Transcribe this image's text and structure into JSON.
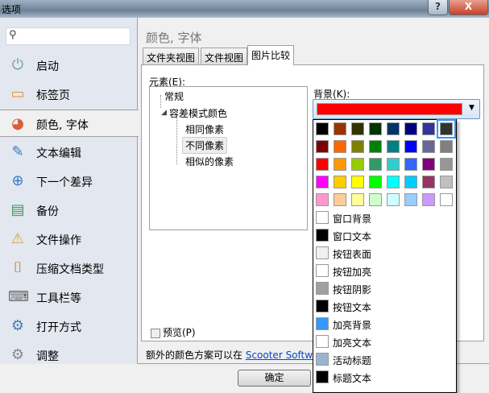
{
  "window": {
    "title": "选项",
    "help": "?",
    "close": "X"
  },
  "sidebar": {
    "search_placeholder": "",
    "items": [
      {
        "label": "启动",
        "icon": "power-icon",
        "glyph": "⏻",
        "color": "#6aa88a"
      },
      {
        "label": "标签页",
        "icon": "tab-icon",
        "glyph": "▭",
        "color": "#e8913a"
      },
      {
        "label": "颜色, 字体",
        "icon": "palette-icon",
        "glyph": "◕",
        "color": "#d9603b",
        "selected": true
      },
      {
        "label": "文本编辑",
        "icon": "notepad-pencil-icon",
        "glyph": "✎",
        "color": "#3a78c2"
      },
      {
        "label": "下一个差异",
        "icon": "arrow-down-circle-icon",
        "glyph": "⊕",
        "color": "#3a78c2"
      },
      {
        "label": "备份",
        "icon": "backup-document-icon",
        "glyph": "▤",
        "color": "#3a9a5a"
      },
      {
        "label": "文件操作",
        "icon": "file-warning-icon",
        "glyph": "⚠",
        "color": "#e0a030"
      },
      {
        "label": "压缩文档类型",
        "icon": "archive-clamp-icon",
        "glyph": "⌷",
        "color": "#d08020"
      },
      {
        "label": "工具栏等",
        "icon": "keyboard-icon",
        "glyph": "⌨",
        "color": "#666"
      },
      {
        "label": "打开方式",
        "icon": "window-gear-icon",
        "glyph": "⚙",
        "color": "#4a7ab0"
      },
      {
        "label": "调整",
        "icon": "gears-icon",
        "glyph": "⚙",
        "color": "#888"
      }
    ]
  },
  "main": {
    "heading": "颜色, 字体",
    "tabs": [
      {
        "label": "文件夹视图"
      },
      {
        "label": "文件视图"
      },
      {
        "label": "图片比较",
        "active": true
      }
    ],
    "elements_label": "元素(E):",
    "tree": [
      {
        "label": "常规",
        "level": 0
      },
      {
        "label": "容差模式颜色",
        "level": 0,
        "expanded": true
      },
      {
        "label": "相同像素",
        "level": 1
      },
      {
        "label": "不同像素",
        "level": 1,
        "selected": true
      },
      {
        "label": "相似的像素",
        "level": 1
      }
    ],
    "background_label": "背景(K):",
    "background_value": "#ff0000",
    "preview_label": "预览(P)",
    "extra_text": "额外的颜色方案可以在 ",
    "extra_link": "Scooter Software",
    "ok_label": "确定"
  },
  "palette": [
    [
      "#000000",
      "#993300",
      "#333300",
      "#003300",
      "#003366",
      "#000080",
      "#333399",
      "#333333"
    ],
    [
      "#800000",
      "#ff6600",
      "#808000",
      "#008000",
      "#008080",
      "#0000ff",
      "#666699",
      "#808080"
    ],
    [
      "#ff0000",
      "#ff9900",
      "#99cc00",
      "#339966",
      "#33cccc",
      "#3366ff",
      "#800080",
      "#969696"
    ],
    [
      "#ff00ff",
      "#ffcc00",
      "#ffff00",
      "#00ff00",
      "#00ffff",
      "#00ccff",
      "#993366",
      "#c0c0c0"
    ],
    [
      "#ff99cc",
      "#ffcc99",
      "#ffff99",
      "#ccffcc",
      "#ccffff",
      "#99ccff",
      "#cc99ff",
      "#ffffff"
    ]
  ],
  "system_colors": [
    {
      "label": "窗口背景",
      "color": "#ffffff"
    },
    {
      "label": "窗口文本",
      "color": "#000000"
    },
    {
      "label": "按钮表面",
      "color": "#f0f0f0"
    },
    {
      "label": "按钮加亮",
      "color": "#ffffff"
    },
    {
      "label": "按钮阴影",
      "color": "#a0a0a0"
    },
    {
      "label": "按钮文本",
      "color": "#000000"
    },
    {
      "label": "加亮背景",
      "color": "#3399ff"
    },
    {
      "label": "加亮文本",
      "color": "#ffffff"
    },
    {
      "label": "活动标题",
      "color": "#99b4d1"
    },
    {
      "label": "标题文本",
      "color": "#000000"
    }
  ]
}
